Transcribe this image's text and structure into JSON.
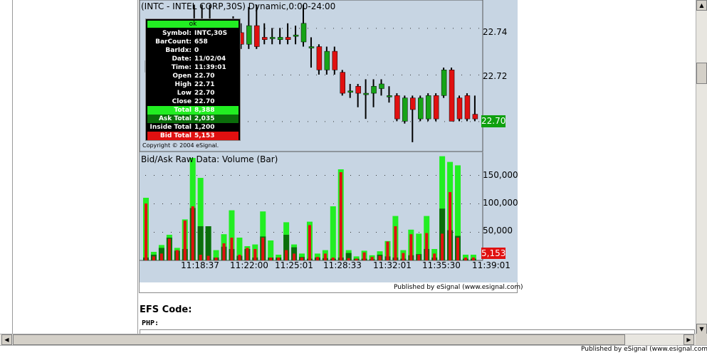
{
  "price_chart": {
    "title": "(INTC - INTEL CORP,30S) Dynamic,0:00-24:00",
    "copyright": "Copyright © 2004 eSignal.",
    "price_ticks": [
      "22.74",
      "22.72"
    ],
    "last_price": "22.70",
    "colors": {
      "up": "#17a317",
      "down": "#e01010",
      "last_price_bg": "#0fa00f"
    }
  },
  "tooltip": {
    "header": "ok",
    "rows": [
      {
        "label": "Symbol:",
        "value": "INTC,30S"
      },
      {
        "label": "BarCount:",
        "value": "658"
      },
      {
        "label": "BarIdx:",
        "value": "0"
      },
      {
        "label": "Date:",
        "value": "11/02/04"
      },
      {
        "label": "Time:",
        "value": "11:39:01"
      },
      {
        "label": "Open",
        "value": "22.70"
      },
      {
        "label": "High",
        "value": "22.71"
      },
      {
        "label": "Low",
        "value": "22.70"
      },
      {
        "label": "Close",
        "value": "22.70"
      },
      {
        "label": "Total",
        "value": "8,388"
      },
      {
        "label": "Ask Total",
        "value": "2,035"
      },
      {
        "label": "Inside Total",
        "value": "1,200"
      },
      {
        "label": "Bid Total",
        "value": "5,153"
      }
    ]
  },
  "volume_chart": {
    "title": "Bid/Ask Raw Data: Volume (Bar)",
    "volume_ticks": [
      "150,000",
      "100,000",
      "50,000"
    ],
    "last_value": "5,153",
    "time_ticks": [
      "11:18:37",
      "11:22:00",
      "11:25:01",
      "11:28:33",
      "11:32:01",
      "11:35:30",
      "11:39:01"
    ]
  },
  "published_inner": "Published by eSignal (www.esignal.com)",
  "published_outer": "Published by eSignal (www.esignal.com)",
  "efs_heading": "EFS Code:",
  "php_label": "PHP:",
  "chart_data": [
    {
      "type": "bar",
      "title": "(INTC - INTEL CORP,30S) Dynamic,0:00-24:00",
      "subtype": "price-ohlc",
      "y_ticks": [
        22.74,
        22.72,
        22.7
      ],
      "ylim": [
        22.687,
        22.752
      ],
      "grid": true,
      "bars": [
        {
          "o": 22.726,
          "c": 22.721,
          "h": 22.729,
          "l": 22.719
        },
        {
          "o": 22.725,
          "c": 22.72,
          "h": 22.73,
          "l": 22.718
        },
        {
          "o": 22.72,
          "c": 22.724,
          "h": 22.727,
          "l": 22.717
        },
        {
          "o": 22.722,
          "c": 22.726,
          "h": 22.73,
          "l": 22.72
        },
        {
          "o": 22.725,
          "c": 22.729,
          "h": 22.732,
          "l": 22.723
        },
        {
          "o": 22.73,
          "c": 22.734,
          "h": 22.738,
          "l": 22.728
        },
        {
          "o": 22.735,
          "c": 22.74,
          "h": 22.75,
          "l": 22.733
        },
        {
          "o": 22.741,
          "c": 22.74,
          "h": 22.75,
          "l": 22.74
        },
        {
          "o": 22.742,
          "c": 22.737,
          "h": 22.75,
          "l": 22.735
        },
        {
          "o": 22.738,
          "c": 22.733,
          "h": 22.742,
          "l": 22.73
        },
        {
          "o": 22.733,
          "c": 22.737,
          "h": 22.741,
          "l": 22.731
        },
        {
          "o": 22.737,
          "c": 22.737,
          "h": 22.745,
          "l": 22.733
        },
        {
          "o": 22.738,
          "c": 22.733,
          "h": 22.742,
          "l": 22.731
        },
        {
          "o": 22.733,
          "c": 22.741,
          "h": 22.749,
          "l": 22.731
        },
        {
          "o": 22.741,
          "c": 22.732,
          "h": 22.75,
          "l": 22.731
        },
        {
          "o": 22.736,
          "c": 22.735,
          "h": 22.742,
          "l": 22.733
        },
        {
          "o": 22.736,
          "c": 22.736,
          "h": 22.74,
          "l": 22.733
        },
        {
          "o": 22.735,
          "c": 22.736,
          "h": 22.74,
          "l": 22.733
        },
        {
          "o": 22.736,
          "c": 22.735,
          "h": 22.742,
          "l": 22.733
        },
        {
          "o": 22.737,
          "c": 22.737,
          "h": 22.741,
          "l": 22.733
        },
        {
          "o": 22.734,
          "c": 22.742,
          "h": 22.75,
          "l": 22.732
        },
        {
          "o": 22.732,
          "c": 22.732,
          "h": 22.736,
          "l": 22.723
        },
        {
          "o": 22.732,
          "c": 22.722,
          "h": 22.733,
          "l": 22.72
        },
        {
          "o": 22.722,
          "c": 22.73,
          "h": 22.732,
          "l": 22.72
        },
        {
          "o": 22.73,
          "c": 22.722,
          "h": 22.732,
          "l": 22.72
        },
        {
          "o": 22.721,
          "c": 22.712,
          "h": 22.722,
          "l": 22.711
        },
        {
          "o": 22.713,
          "c": 22.713,
          "h": 22.716,
          "l": 22.71
        },
        {
          "o": 22.715,
          "c": 22.712,
          "h": 22.716,
          "l": 22.706
        },
        {
          "o": 22.712,
          "c": 22.712,
          "h": 22.718,
          "l": 22.701
        },
        {
          "o": 22.712,
          "c": 22.715,
          "h": 22.718,
          "l": 22.706
        },
        {
          "o": 22.714,
          "c": 22.716,
          "h": 22.718,
          "l": 22.711
        },
        {
          "o": 22.711,
          "c": 22.711,
          "h": 22.715,
          "l": 22.708
        },
        {
          "o": 22.711,
          "c": 22.701,
          "h": 22.712,
          "l": 22.7
        },
        {
          "o": 22.7,
          "c": 22.71,
          "h": 22.711,
          "l": 22.699
        },
        {
          "o": 22.71,
          "c": 22.705,
          "h": 22.711,
          "l": 22.691
        },
        {
          "o": 22.701,
          "c": 22.71,
          "h": 22.711,
          "l": 22.7
        },
        {
          "o": 22.701,
          "c": 22.711,
          "h": 22.712,
          "l": 22.7
        },
        {
          "o": 22.711,
          "c": 22.701,
          "h": 22.712,
          "l": 22.7
        },
        {
          "o": 22.711,
          "c": 22.722,
          "h": 22.723,
          "l": 22.71
        },
        {
          "o": 22.722,
          "c": 22.7,
          "h": 22.723,
          "l": 22.7
        },
        {
          "o": 22.71,
          "c": 22.701,
          "h": 22.711,
          "l": 22.7
        },
        {
          "o": 22.711,
          "c": 22.701,
          "h": 22.712,
          "l": 22.7
        },
        {
          "o": 22.703,
          "c": 22.701,
          "h": 22.711,
          "l": 22.7
        }
      ]
    },
    {
      "type": "bar",
      "title": "Bid/Ask Raw Data: Volume (Bar)",
      "y_ticks": [
        150000,
        100000,
        50000
      ],
      "ylim": [
        0,
        190000
      ],
      "grid": true,
      "x_tick_labels": [
        "11:18:37",
        "11:22:00",
        "11:25:01",
        "11:28:33",
        "11:32:01",
        "11:35:30",
        "11:39:01"
      ],
      "series": [
        {
          "name": "Total",
          "color": "#22ee22",
          "values": [
            110000,
            15000,
            27000,
            45000,
            22000,
            72000,
            180000,
            145000,
            60000,
            18000,
            46000,
            88000,
            40000,
            25000,
            28000,
            86000,
            35000,
            10000,
            67000,
            28000,
            12000,
            68000,
            12000,
            18000,
            95000,
            160000,
            18000,
            7000,
            17000,
            9000,
            16000,
            34000,
            78000,
            18000,
            54000,
            47000,
            78000,
            20000,
            183000,
            173000,
            167000,
            10000,
            10000
          ]
        },
        {
          "name": "Ask Total",
          "color": "#0b6e0b",
          "values": [
            5000,
            10000,
            22000,
            40000,
            17000,
            20000,
            92000,
            60000,
            60000,
            5000,
            24000,
            20000,
            8000,
            20000,
            5000,
            42000,
            5000,
            5000,
            45000,
            23000,
            6000,
            3000,
            5000,
            4000,
            3000,
            5000,
            13000,
            3000,
            3000,
            2000,
            10000,
            7000,
            5000,
            3000,
            9000,
            11000,
            20000,
            5000,
            91000,
            53000,
            43000,
            3000,
            3000
          ]
        },
        {
          "name": "Bid Total",
          "color": "#e01010",
          "values": [
            100000,
            7000,
            12000,
            38000,
            18000,
            70000,
            95000,
            10000,
            8000,
            5000,
            30000,
            40000,
            10000,
            22000,
            20000,
            40000,
            5000,
            5000,
            18000,
            12000,
            5000,
            62000,
            6000,
            12000,
            5000,
            155000,
            4000,
            3000,
            14000,
            6000,
            8000,
            33000,
            60000,
            13000,
            46000,
            10000,
            48000,
            12000,
            47000,
            120000,
            40000,
            5000,
            5153
          ]
        }
      ]
    }
  ]
}
